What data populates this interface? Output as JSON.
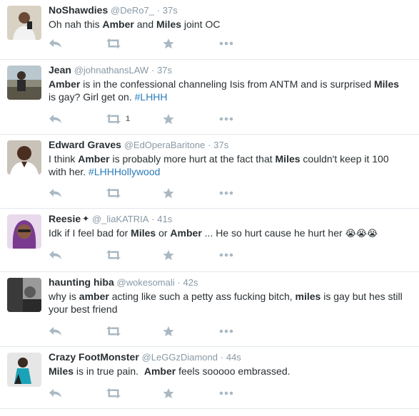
{
  "tweets": [
    {
      "fullname": "NoShawdies",
      "username": "@DeRo7_",
      "separator": "·",
      "time": "37s",
      "badge": "",
      "segments": [
        {
          "t": "Oh nah this ",
          "s": "n"
        },
        {
          "t": "Amber",
          "s": "b"
        },
        {
          "t": " and ",
          "s": "n"
        },
        {
          "t": "Miles",
          "s": "b"
        },
        {
          "t": " joint OC",
          "s": "n"
        }
      ],
      "retweet_count": "",
      "avatar_icon": "user-photo"
    },
    {
      "fullname": "Jean",
      "username": "@johnathansLAW",
      "separator": "·",
      "time": "37s",
      "badge": "",
      "segments": [
        {
          "t": "Amber",
          "s": "b"
        },
        {
          "t": " is in the confessional channeling Isis from ANTM and is surprised ",
          "s": "n"
        },
        {
          "t": "Miles",
          "s": "b"
        },
        {
          "t": "\nis gay? Girl get on. ",
          "s": "n"
        },
        {
          "t": "#LHHH",
          "s": "h"
        }
      ],
      "retweet_count": "1",
      "avatar_icon": "user-photo"
    },
    {
      "fullname": "Edward Graves",
      "username": "@EdOperaBaritone",
      "separator": "·",
      "time": "37s",
      "badge": "",
      "segments": [
        {
          "t": "I think ",
          "s": "n"
        },
        {
          "t": "Amber",
          "s": "b"
        },
        {
          "t": " is probably more hurt at the fact that ",
          "s": "n"
        },
        {
          "t": "Miles",
          "s": "b"
        },
        {
          "t": " couldn't keep it 100\nwith her. ",
          "s": "n"
        },
        {
          "t": "#LHHHollywood",
          "s": "h"
        }
      ],
      "retweet_count": "",
      "avatar_icon": "user-photo"
    },
    {
      "fullname": "Reesie",
      "username": "@_liaKATRIA",
      "separator": "·",
      "time": "41s",
      "badge": "✦",
      "segments": [
        {
          "t": "Idk if I feel bad for ",
          "s": "n"
        },
        {
          "t": "Miles",
          "s": "b"
        },
        {
          "t": " or ",
          "s": "n"
        },
        {
          "t": "Amber",
          "s": "b"
        },
        {
          "t": " ... He so hurt cause he hurt her ",
          "s": "n"
        },
        {
          "t": "😭😭😭",
          "s": "e"
        }
      ],
      "retweet_count": "",
      "avatar_icon": "user-photo"
    },
    {
      "fullname": "haunting hiba",
      "username": "@wokesomali",
      "separator": "·",
      "time": "42s",
      "badge": "",
      "segments": [
        {
          "t": "why is ",
          "s": "n"
        },
        {
          "t": "amber",
          "s": "b"
        },
        {
          "t": " acting like such a petty ass fucking bitch, ",
          "s": "n"
        },
        {
          "t": "miles",
          "s": "b"
        },
        {
          "t": " is gay but hes still\nyour best friend",
          "s": "n"
        }
      ],
      "retweet_count": "",
      "avatar_icon": "user-photo"
    },
    {
      "fullname": "Crazy FootMonster",
      "username": "@LeGGzDiamond",
      "separator": "·",
      "time": "44s",
      "badge": "",
      "segments": [
        {
          "t": "Miles",
          "s": "b"
        },
        {
          "t": " is in true pain.  ",
          "s": "n"
        },
        {
          "t": "Amber",
          "s": "b"
        },
        {
          "t": " feels sooooo embrassed.",
          "s": "n"
        }
      ],
      "retweet_count": "",
      "avatar_icon": "user-photo"
    }
  ],
  "icons": {
    "reply": "reply-icon",
    "retweet": "retweet-icon",
    "favorite": "star-icon",
    "more": "more-dots-icon"
  },
  "colors": {
    "name": "#292f33",
    "meta": "#8899a6",
    "hashtag": "#2b7bb9",
    "action_icons": "#aab8c2",
    "divider": "#e1e8ed"
  }
}
